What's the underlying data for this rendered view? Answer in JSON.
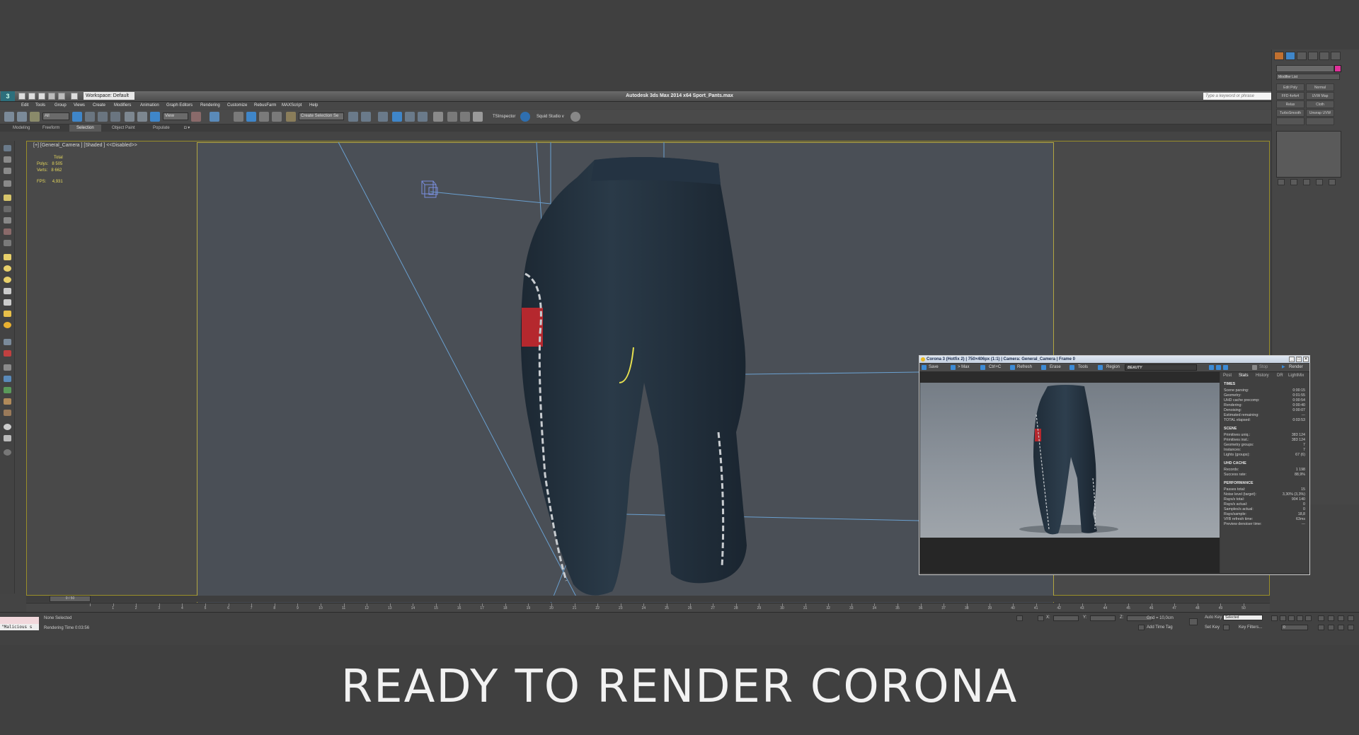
{
  "titlebar": {
    "app_title": "Autodesk 3ds Max  2014 x64    Sport_Pants.max",
    "workspace": "Workspace: Default",
    "search_placeholder": "Type a keyword or phrase"
  },
  "menu": [
    "Edit",
    "Tools",
    "Group",
    "Views",
    "Create",
    "Modifiers",
    "Animation",
    "Graph Editors",
    "Rendering",
    "Customize",
    "RebusFarm",
    "MAXScript",
    "Help"
  ],
  "toolbar": {
    "filter": "All",
    "ref_coord": "View",
    "selection_set": "Create Selection Se",
    "tsinspector": "TSInspector",
    "squid_studio": "Squid Studio v"
  },
  "ribbon_tabs": [
    "Modeling",
    "Freeform",
    "Selection",
    "Object Paint",
    "Populate"
  ],
  "ribbon_active": "Selection",
  "viewport": {
    "label": "[+] [General_Camera ] [Shaded ]  <<Disabled>>",
    "stats_header": "Total",
    "polys_label": "Polys:",
    "polys_value": "8 505",
    "verts_label": "Verts:",
    "verts_value": "8 662",
    "fps_label": "FPS:",
    "fps_value": "4,931"
  },
  "command_panel": {
    "modifier_list": "Modifier List",
    "buttons": [
      "Edit Poly",
      "Normal",
      "FFD 4x4x4",
      "UVW Map",
      "Relax",
      "Cloth",
      "TurboSmooth",
      "Unwrap UVW"
    ]
  },
  "corona": {
    "title": "Corona 3 (Hotfix 2) | 750×406px (1:1) | Camera: General_Camera | Frame 0",
    "toolbar": [
      "Save",
      "> Max",
      "Ctrl+C",
      "Refresh",
      "Erase",
      "Tools",
      "Region"
    ],
    "beauty": "BEAUTY",
    "stop": "Stop",
    "render": "Render",
    "tabs": [
      "Post",
      "Stats",
      "History",
      "DR",
      "LightMix"
    ],
    "active_tab": "Stats",
    "sections": [
      {
        "title": "TIMES",
        "rows": [
          [
            "Scene parsing:",
            "0:00:15"
          ],
          [
            "Geometry:",
            "0:01:55"
          ],
          [
            "UHD cache precomp:",
            "0:00:54"
          ],
          [
            "Rendering:",
            "0:00:40"
          ],
          [
            "Denoising:",
            "0:00:07"
          ],
          [
            "Estimated remaining:",
            "---"
          ],
          [
            "TOTAL elapsed:",
            "0:03:53"
          ]
        ]
      },
      {
        "title": "SCENE",
        "rows": [
          [
            "Primitives uniq.:",
            "383 124"
          ],
          [
            "Primitives inst.:",
            "383 124"
          ],
          [
            "Geometry groups:",
            "7"
          ],
          [
            "Instances:",
            "7"
          ],
          [
            "Lights (groups):",
            "67 (6)"
          ]
        ]
      },
      {
        "title": "UHD CACHE",
        "rows": [
          [
            "Records:",
            "1 198"
          ],
          [
            "Success rate:",
            "88,9%"
          ]
        ]
      },
      {
        "title": "PERFORMANCE",
        "rows": [
          [
            "Passes total:",
            "15"
          ],
          [
            "Noise level (target):",
            "3,30% (3,3%)"
          ],
          [
            "Rays/s total:",
            "904 140"
          ],
          [
            "Rays/s actual:",
            "0"
          ],
          [
            "Samples/s actual:",
            "0"
          ],
          [
            "Rays/sample:",
            "18,8"
          ],
          [
            "VFB refresh time:",
            "63ms"
          ],
          [
            "Preview denoiser time:",
            "---"
          ]
        ]
      }
    ]
  },
  "timeline": {
    "slider": "0 / 50",
    "ticks": [
      "0",
      "1",
      "2",
      "3",
      "4",
      "5",
      "6",
      "7",
      "8",
      "9",
      "10",
      "11",
      "12",
      "13",
      "14",
      "15",
      "16",
      "17",
      "18",
      "19",
      "20",
      "21",
      "22",
      "23",
      "24",
      "25",
      "26",
      "27",
      "28",
      "29",
      "30",
      "31",
      "32",
      "33",
      "34",
      "35",
      "36",
      "37",
      "38",
      "39",
      "40",
      "41",
      "42",
      "43",
      "44",
      "45",
      "46",
      "47",
      "48",
      "49",
      "50"
    ]
  },
  "status": {
    "maxscript": "\"Malicious s",
    "selection": "None Selected",
    "render_time": "Rendering Time  0:03:56",
    "grid": "Grid = 10,0cm",
    "add_time_tag": "Add Time Tag",
    "auto_key": "Auto Key",
    "set_key": "Set Key",
    "selected": "Selected",
    "key_filters": "Key Filters...",
    "frame": "0"
  },
  "headline": "READY TO RENDER CORONA"
}
